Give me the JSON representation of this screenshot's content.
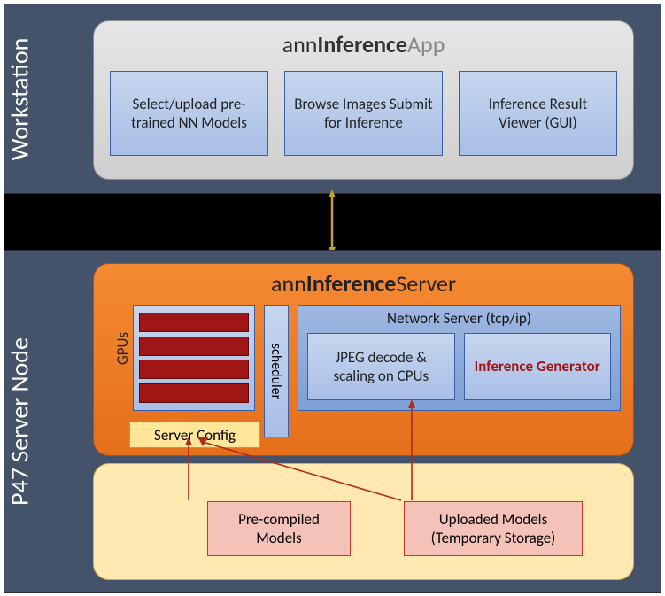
{
  "workstation": {
    "label": "Workstation",
    "app": {
      "title_pre": "ann",
      "title_mid": "Inference",
      "title_suf": "App",
      "boxes": [
        "Select/upload pre-trained NN Models",
        "Browse Images Submit for Inference",
        "Inference Result Viewer (GUI)"
      ]
    }
  },
  "server_node": {
    "label": "P47 Server Node",
    "server": {
      "title_pre": "ann",
      "title_mid": "Inference",
      "title_suf": "Server",
      "gpus_label": "GPUs",
      "gpu_count": 4,
      "server_config": "Server Config",
      "scheduler": "scheduler",
      "network_title": "Network Server  (tcp/ip)",
      "jpeg": "JPEG decode & scaling on CPUs",
      "inference_gen": "Inference Generator"
    },
    "storage": {
      "precompiled": "Pre-compiled Models",
      "uploaded": "Uploaded Models (Temporary Storage)"
    }
  },
  "colors": {
    "panel": "#44536a",
    "orange": "#ed7d31",
    "blue_box": "#b4c7e7",
    "yellow": "#ffe699",
    "pink": "#f5c2b8",
    "red": "#a01515",
    "arrow_gold": "#bfa32a"
  }
}
